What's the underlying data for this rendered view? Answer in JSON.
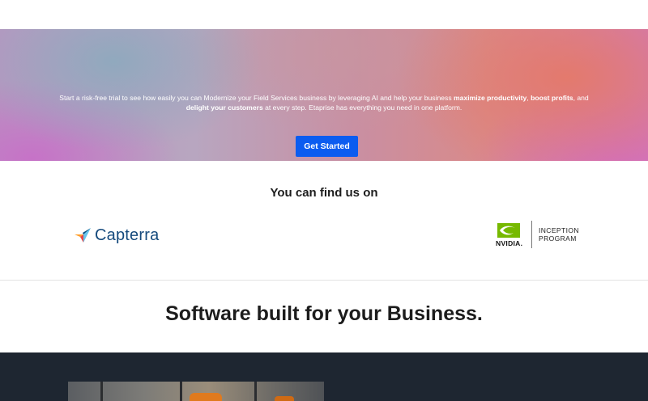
{
  "hero": {
    "text_part1": "Start a risk-free trial to see how easily you can Modernize your Field Services business by leveraging AI and help your business ",
    "bold1": "maximize productivity",
    "sep1": ", ",
    "bold2": "boost profits",
    "sep2": ", and ",
    "bold3": "delight your customers",
    "text_part2": " at every step. Etaprise has everything you need in one platform.",
    "cta_label": "Get Started",
    "cta_color": "#0b5cf0"
  },
  "partners": {
    "title": "You can find us on",
    "capterra_label": "Capterra",
    "nvidia_word": "NVIDIA.",
    "nvidia_program_line1": "INCEPTION",
    "nvidia_program_line2": "PROGRAM"
  },
  "section": {
    "title": "Software built for your Business."
  },
  "icons": {
    "capterra": "capterra-logo-icon",
    "nvidia": "nvidia-eye-icon"
  }
}
